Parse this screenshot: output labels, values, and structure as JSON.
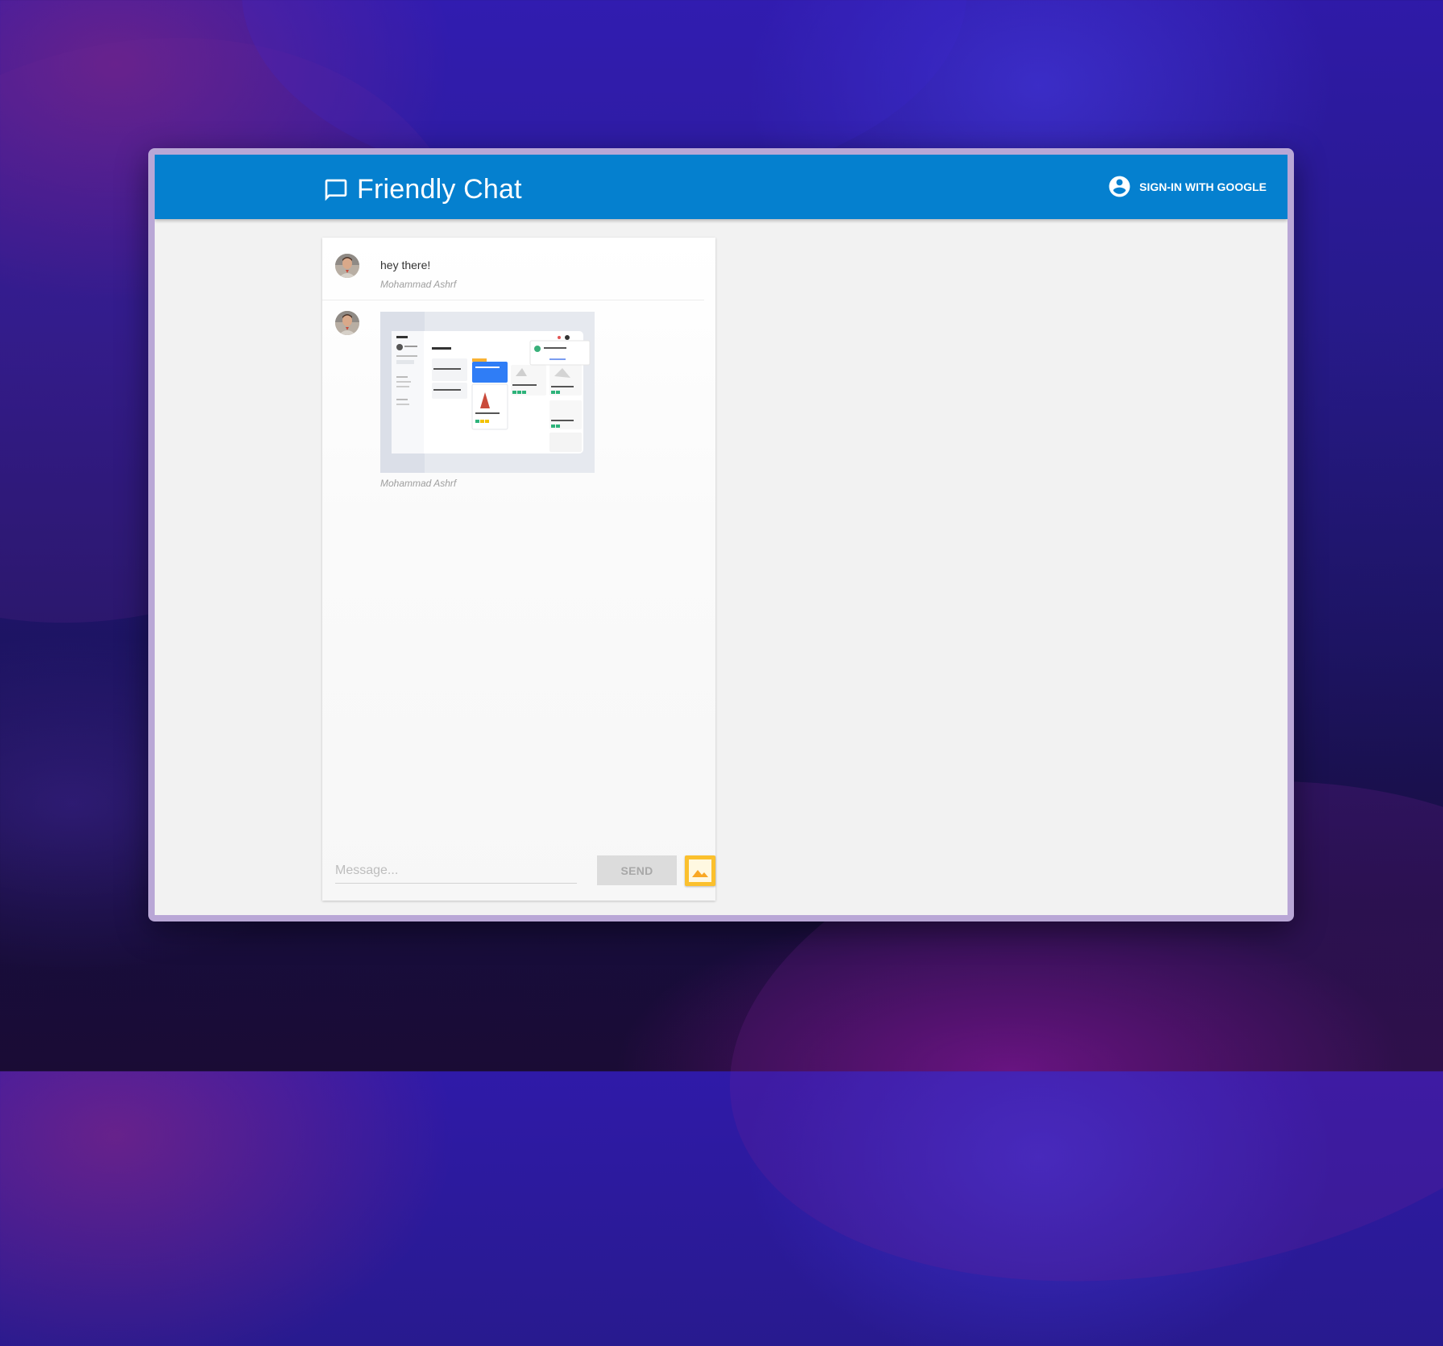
{
  "header": {
    "title": "Friendly Chat",
    "signin_label": "SIGN-IN WITH GOOGLE",
    "brand_icon": "chat-bubble-icon",
    "account_icon": "account-circle-icon"
  },
  "messages": [
    {
      "text": "hey there!",
      "author": "Mohammad Ashrf"
    },
    {
      "text": "",
      "author": "Mohammad Ashrf",
      "has_image": true
    }
  ],
  "composer": {
    "placeholder": "Message...",
    "send_label": "SEND",
    "image_button_icon": "image-icon"
  },
  "colors": {
    "header": "#0580cf",
    "send_disabled_bg": "#dcdcdc",
    "image_button": "#fbc02d"
  }
}
